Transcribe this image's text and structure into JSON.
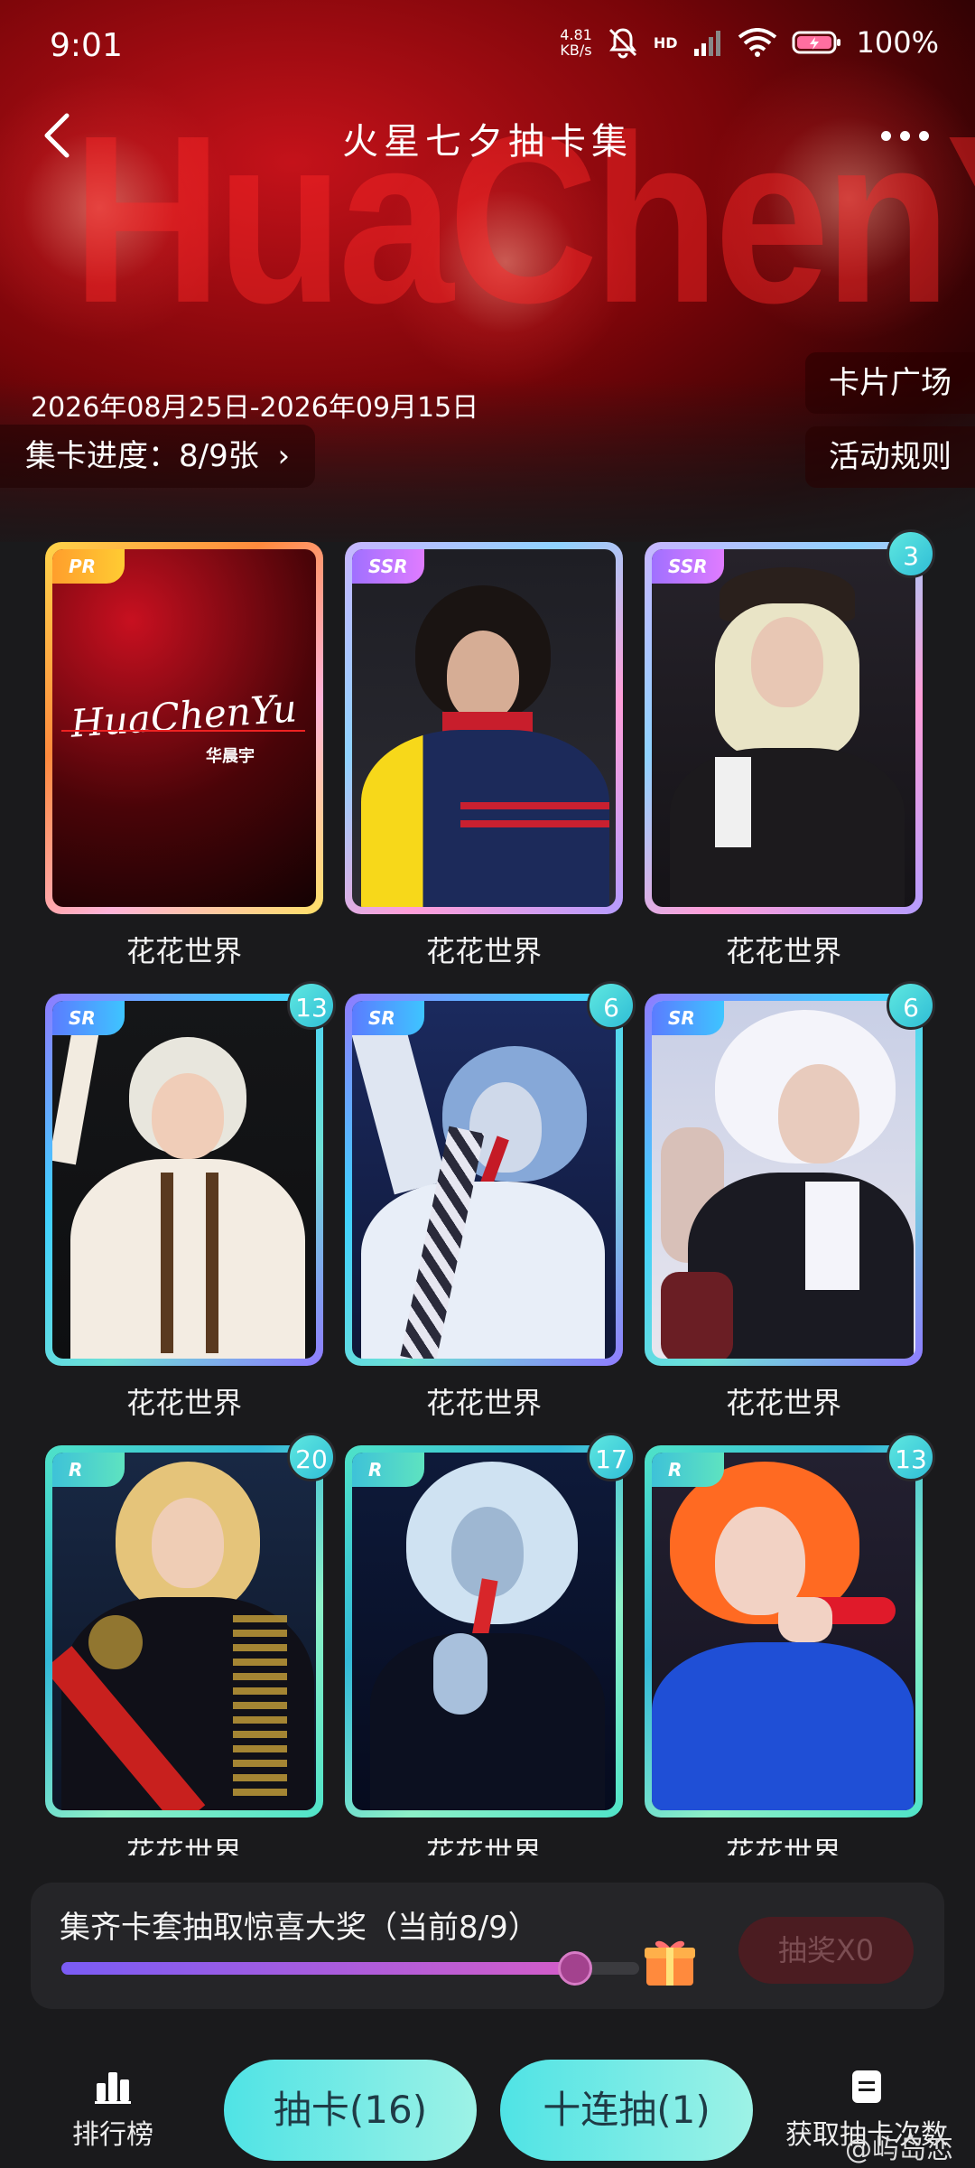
{
  "status": {
    "time": "9:01",
    "speed_top": "4.81",
    "speed_unit": "KB/s",
    "network": "HD",
    "battery": "100%"
  },
  "header": {
    "title": "火星七夕抽卡集",
    "banner_text": "HuaChenYu"
  },
  "hero": {
    "date_range": "2026年08月25日-2026年09月15日",
    "card_square": "卡片广场",
    "rules": "活动规则",
    "progress": "集卡进度：8/9张"
  },
  "cards": [
    {
      "rarity": "PR",
      "count": "",
      "name": "花花世界",
      "logo_text": "HuaChenYu",
      "logo_sub": "华晨宇"
    },
    {
      "rarity": "SSR",
      "count": "",
      "name": "花花世界"
    },
    {
      "rarity": "SSR",
      "count": "3",
      "name": "花花世界"
    },
    {
      "rarity": "SR",
      "count": "13",
      "name": "花花世界"
    },
    {
      "rarity": "SR",
      "count": "6",
      "name": "花花世界"
    },
    {
      "rarity": "SR",
      "count": "6",
      "name": "花花世界"
    },
    {
      "rarity": "R",
      "count": "20",
      "name": "花花世界"
    },
    {
      "rarity": "R",
      "count": "17",
      "name": "花花世界"
    },
    {
      "rarity": "R",
      "count": "13",
      "name": "花花世界"
    }
  ],
  "prize": {
    "text": "集齐卡套抽取惊喜大奖（当前8/9）",
    "progress": 0.889,
    "button": "抽奖X0"
  },
  "nav": {
    "ranking": "排行榜",
    "draw": "抽卡(16)",
    "ten_draw": "十连抽(1)",
    "get_chances": "获取抽卡次数"
  },
  "watermark": "@屿岛恋",
  "colors": {
    "accent_cyan": "#4fe3e5",
    "hero_red": "#c4121a",
    "bg": "#1a1a1c"
  }
}
